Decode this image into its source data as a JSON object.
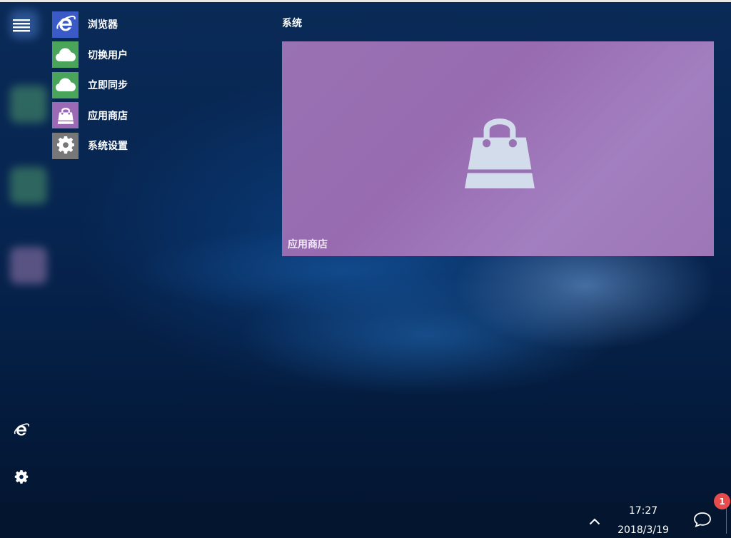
{
  "app_list": [
    {
      "label": "浏览器",
      "icon": "ie-icon",
      "color": "#3a5bc7"
    },
    {
      "label": "切换用户",
      "icon": "cloud-icon",
      "color": "#4aa55a"
    },
    {
      "label": "立即同步",
      "icon": "cloud-icon",
      "color": "#4aa55a"
    },
    {
      "label": "应用商店",
      "icon": "store-bag-icon",
      "color": "#9c6ab5"
    },
    {
      "label": "系统设置",
      "icon": "gear-icon",
      "color": "#777777"
    }
  ],
  "group": {
    "title": "系统"
  },
  "tile": {
    "label": "应用商店",
    "icon": "store-bag-icon",
    "color": "#9972b3"
  },
  "rail": {
    "menu_icon": "hamburger-icon",
    "bottom_icons": [
      "ie-icon",
      "gear-icon",
      "logo-icon"
    ]
  },
  "taskbar": {
    "time": "17:27",
    "date": "2018/3/19",
    "notification_count": "1",
    "tray_icon": "chevron-up-icon",
    "action_center_icon": "chat-bubble-icon"
  }
}
